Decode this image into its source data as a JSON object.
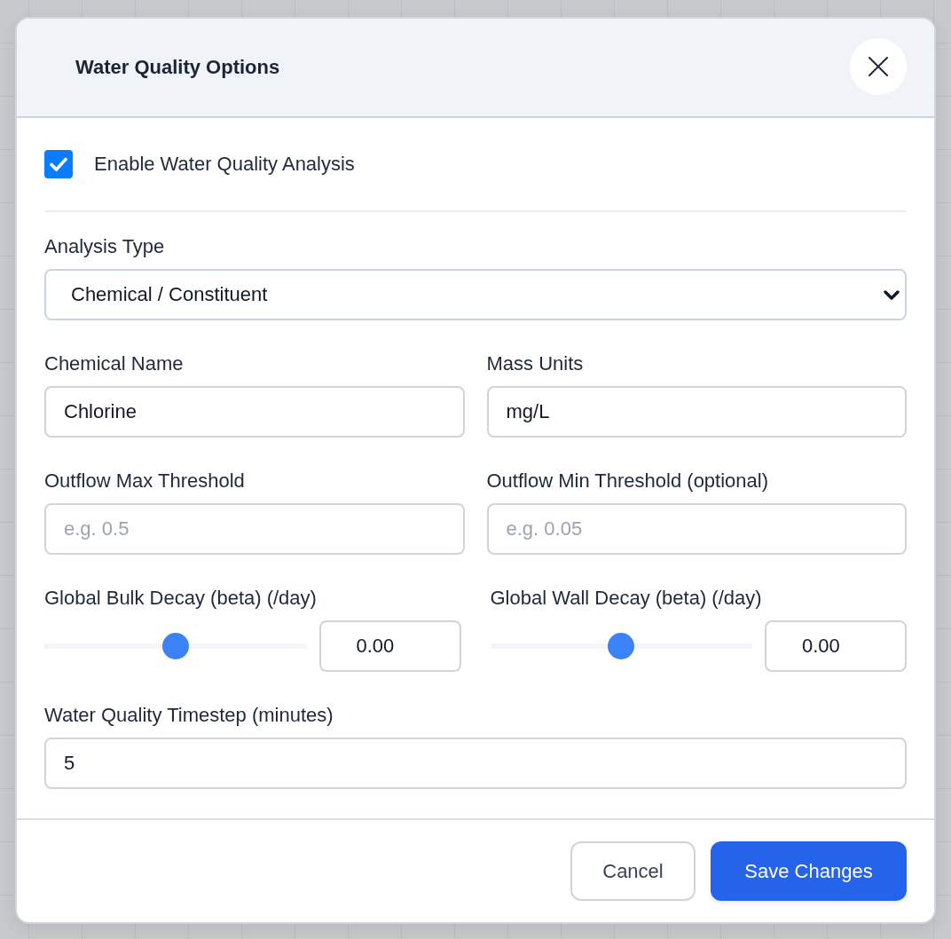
{
  "dialog": {
    "title": "Water Quality Options"
  },
  "enable_checkbox": {
    "label": "Enable Water Quality Analysis",
    "checked": true
  },
  "analysis_type": {
    "label": "Analysis Type",
    "value": "Chemical / Constituent"
  },
  "fields": [
    {
      "label": "Chemical Name",
      "value": "Chlorine"
    },
    {
      "label": "Mass Units",
      "value": "mg/L"
    },
    {
      "label": "Outflow Max Threshold",
      "placeholder": "e.g. 0.5"
    },
    {
      "label": "Outflow Min Threshold (optional)",
      "placeholder": "e.g. 0.05"
    }
  ],
  "decay": [
    {
      "label": "Global Bulk Decay (beta) (/day)",
      "level": 0.5,
      "value": "0.00"
    },
    {
      "label": "Global Wall Decay (beta) (/day)",
      "level": 0.5,
      "value": "0.00"
    }
  ],
  "timestep": {
    "label": "Water Quality Timestep (minutes)",
    "value": "5"
  },
  "buttons": [
    {
      "label": "Cancel",
      "kind": "secondary"
    },
    {
      "label": "Save Changes",
      "kind": "primary"
    }
  ]
}
